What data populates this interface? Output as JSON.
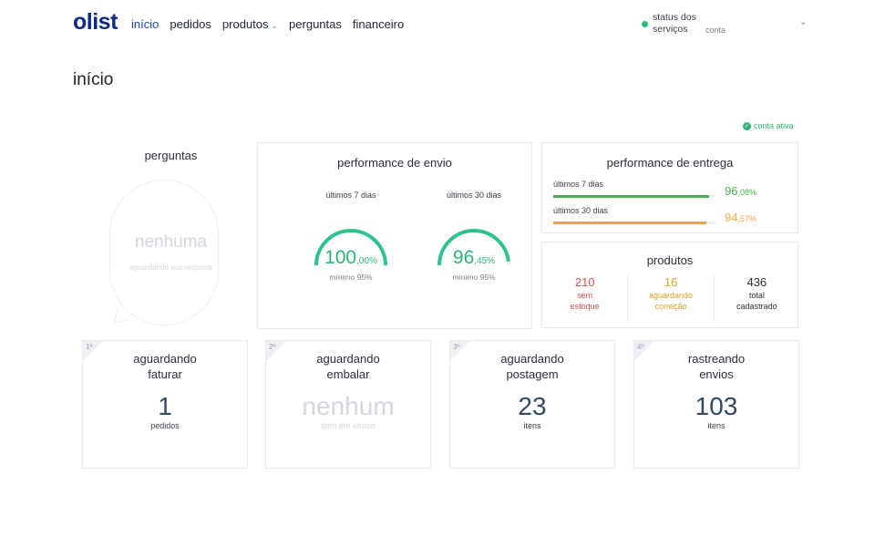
{
  "header": {
    "logo": "olist",
    "nav": [
      {
        "label": "início",
        "active": true
      },
      {
        "label": "pedidos"
      },
      {
        "label": "produtos",
        "has_dropdown": true
      },
      {
        "label": "perguntas"
      },
      {
        "label": "financeiro"
      }
    ],
    "status": "status dos serviços",
    "account": "conta"
  },
  "page_title": "início",
  "conta_ativa": "conta ativa",
  "perguntas": {
    "title": "perguntas",
    "main": "nenhuma",
    "sub": "aguardando sua resposta"
  },
  "envio": {
    "title": "performance de envio",
    "gauges": [
      {
        "period": "últimos 7 dias",
        "value_int": "100",
        "value_dec": ",00%",
        "minimo": "mínimo 95%",
        "percent": 100.0
      },
      {
        "period": "últimos 30 dias",
        "value_int": "96",
        "value_dec": ",45%",
        "minimo": "mínimo 95%",
        "percent": 96.45
      }
    ]
  },
  "entrega": {
    "title": "performance de entrega",
    "rows": [
      {
        "label": "últimos 7 dias",
        "value_int": "96",
        "value_dec": ",08%",
        "percent": 96.08,
        "color": "#4caf50"
      },
      {
        "label": "últimos 30 dias",
        "value_int": "94",
        "value_dec": ",57%",
        "percent": 94.57,
        "color": "#f0a63a"
      }
    ]
  },
  "produtos": {
    "title": "produtos",
    "items": [
      {
        "num": "210",
        "label1": "sem",
        "label2": "estoque",
        "color": "#d9534f"
      },
      {
        "num": "16",
        "label1": "aguardando",
        "label2": "correção",
        "color": "#e0a020"
      },
      {
        "num": "436",
        "label1": "total",
        "label2": "cadastrado",
        "color": "#2b2f3a"
      }
    ]
  },
  "steps": [
    {
      "num": "1º",
      "title1": "aguardando",
      "title2": "faturar",
      "big": "1",
      "sub": "pedidos",
      "muted": false
    },
    {
      "num": "2º",
      "title1": "aguardando",
      "title2": "embalar",
      "big": "nenhum",
      "sub": "item em atraso",
      "muted": true
    },
    {
      "num": "3º",
      "title1": "aguardando",
      "title2": "postagem",
      "big": "23",
      "sub": "itens",
      "muted": false
    },
    {
      "num": "4º",
      "title1": "rastreando",
      "title2": "envios",
      "big": "103",
      "sub": "itens",
      "muted": false
    }
  ],
  "colors": {
    "brand": "#0c2a8a",
    "active_nav": "#1b46c7",
    "success": "#2bb673",
    "muted": "#d4d7de"
  }
}
